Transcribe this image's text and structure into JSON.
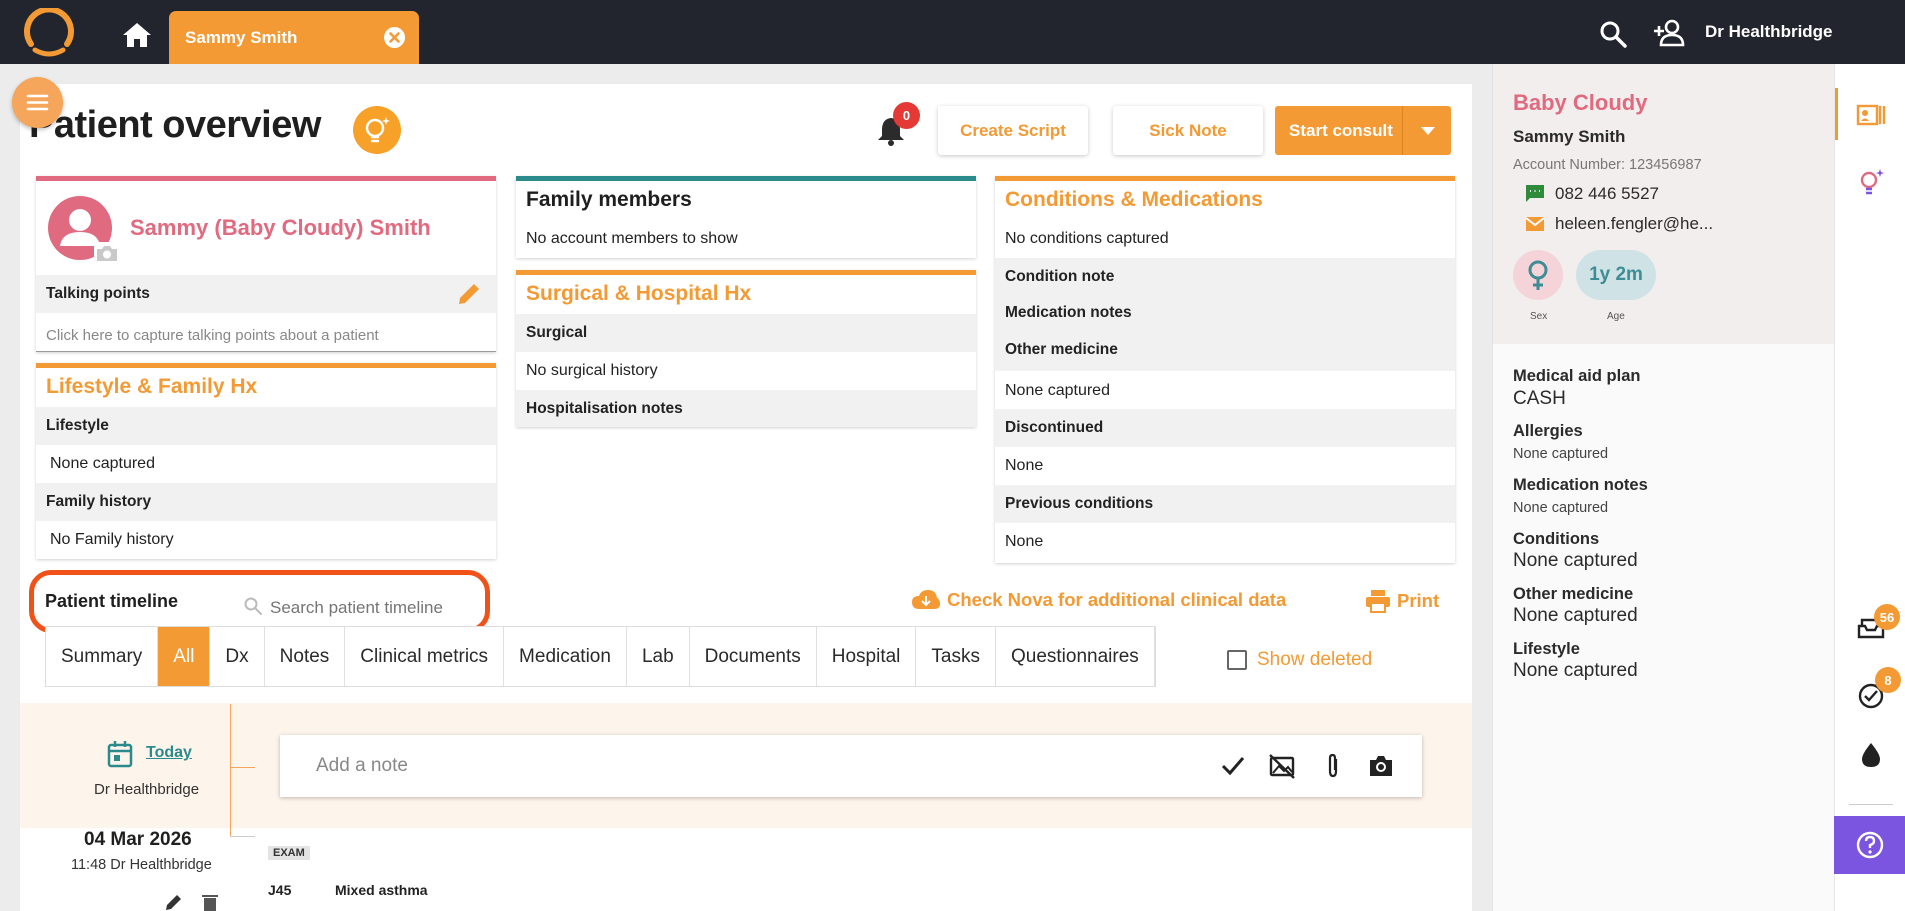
{
  "header": {
    "tab_label": "Sammy Smith",
    "user_name": "Dr Healthbridge"
  },
  "page": {
    "title": "Patient overview",
    "notification_count": "0",
    "create_script": "Create Script",
    "sick_note": "Sick Note",
    "start_consult": "Start consult"
  },
  "patient_card": {
    "name": "Sammy (Baby Cloudy) Smith",
    "talking_points_label": "Talking points",
    "talking_points_placeholder": "Click here to capture talking points about a patient"
  },
  "lifestyle_card": {
    "title": "Lifestyle & Family Hx",
    "lifestyle_label": "Lifestyle",
    "lifestyle_value": "None captured",
    "family_label": "Family history",
    "family_value": "No Family history"
  },
  "family_card": {
    "title": "Family members",
    "value": "No account members to show"
  },
  "surgical_card": {
    "title": "Surgical & Hospital Hx",
    "surgical_label": "Surgical",
    "surgical_value": "No surgical history",
    "hosp_label": "Hospitalisation notes"
  },
  "conditions_card": {
    "title": "Conditions & Medications",
    "no_conditions": "No conditions captured",
    "condition_note": "Condition note",
    "medication_notes": "Medication notes",
    "other_medicine": "Other medicine",
    "other_value": "None captured",
    "discontinued": "Discontinued",
    "discontinued_value": "None",
    "previous": "Previous conditions",
    "previous_value": "None"
  },
  "timeline": {
    "title": "Patient timeline",
    "search_placeholder": "Search patient timeline",
    "nova_link": "Check Nova for additional clinical data",
    "print": "Print",
    "tabs": [
      "Summary",
      "All",
      "Dx",
      "Notes",
      "Clinical metrics",
      "Medication",
      "Lab",
      "Documents",
      "Hospital",
      "Tasks",
      "Questionnaires"
    ],
    "show_deleted": "Show deleted",
    "today_label": "Today",
    "today_doctor": "Dr Healthbridge",
    "note_placeholder": "Add a note",
    "entry_date": "04 Mar 2026",
    "entry_time": "11:48 Dr Healthbridge",
    "entry_badge": "EXAM",
    "entry_code": "J45",
    "entry_name": "Mixed asthma"
  },
  "side_panel": {
    "name": "Baby Cloudy",
    "subname": "Sammy Smith",
    "account": "Account Number: 123456987",
    "phone": "082 446 5527",
    "email": "heleen.fengler@he...",
    "sex_label": "Sex",
    "age_value": "1y 2m",
    "age_label": "Age",
    "medical_aid_label": "Medical aid plan",
    "medical_aid_value": "CASH",
    "allergies_label": "Allergies",
    "allergies_value": "None captured",
    "med_notes_label": "Medication notes",
    "med_notes_value": "None captured",
    "conditions_label": "Conditions",
    "conditions_value": "None captured",
    "other_med_label": "Other medicine",
    "other_med_value": "None captured",
    "lifestyle_label": "Lifestyle",
    "lifestyle_value": "None captured"
  },
  "strip": {
    "inbox_count": "56",
    "tasks_count": "8"
  },
  "colors": {
    "accent": "#f39a34",
    "patient_pink": "#e06a7f",
    "teal": "#2a8a8c",
    "topbar": "#22252e",
    "highlight": "#f0521a"
  }
}
